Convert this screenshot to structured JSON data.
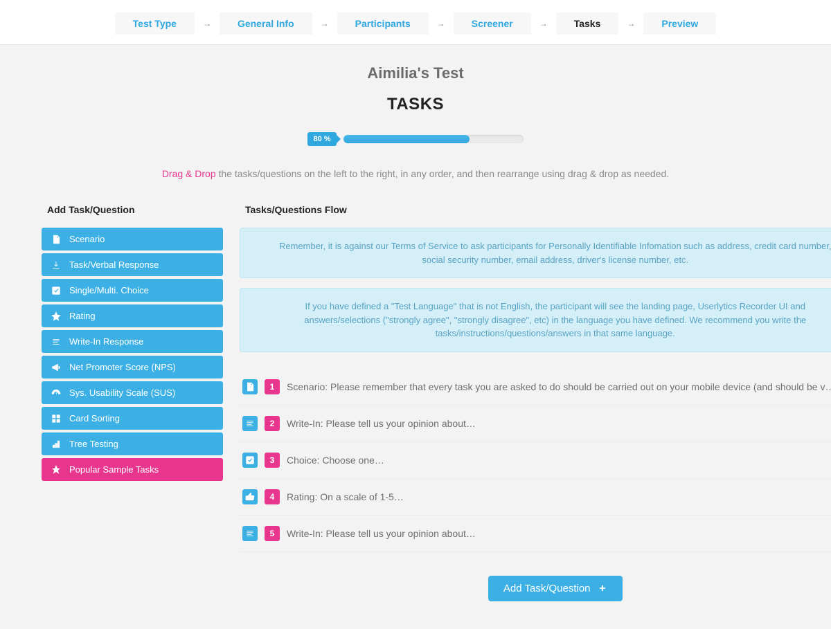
{
  "wizard": {
    "steps": [
      {
        "label": "Test Type",
        "active": false
      },
      {
        "label": "General Info",
        "active": false
      },
      {
        "label": "Participants",
        "active": false
      },
      {
        "label": "Screener",
        "active": false
      },
      {
        "label": "Tasks",
        "active": true
      },
      {
        "label": "Preview",
        "active": false
      }
    ]
  },
  "test_title": "Aimilia's Test",
  "section_title": "TASKS",
  "progress": {
    "label": "80 %",
    "percent": 70
  },
  "instruction": {
    "highlight": "Drag & Drop",
    "rest": " the tasks/questions on the left to the right, in any order, and then rearrange using drag & drop as needed."
  },
  "left": {
    "heading": "Add Task/Question",
    "items": [
      {
        "icon": "file",
        "label": "Scenario",
        "variant": "blue"
      },
      {
        "icon": "download",
        "label": "Task/Verbal Response",
        "variant": "blue"
      },
      {
        "icon": "check",
        "label": "Single/Multi. Choice",
        "variant": "blue"
      },
      {
        "icon": "star",
        "label": "Rating",
        "variant": "blue"
      },
      {
        "icon": "lines",
        "label": "Write-In Response",
        "variant": "blue"
      },
      {
        "icon": "megaphone",
        "label": "Net Promoter Score (NPS)",
        "variant": "blue"
      },
      {
        "icon": "gauge",
        "label": "Sys. Usability Scale (SUS)",
        "variant": "blue"
      },
      {
        "icon": "grid",
        "label": "Card Sorting",
        "variant": "blue"
      },
      {
        "icon": "tree",
        "label": "Tree Testing",
        "variant": "blue"
      },
      {
        "icon": "pin",
        "label": "Popular Sample Tasks",
        "variant": "pink"
      }
    ]
  },
  "right": {
    "heading": "Tasks/Questions Flow",
    "notices": [
      "Remember, it is against our Terms of Service to ask participants for Personally Identifiable Infomation such as address, credit card number, social security number, email address, driver's license number, etc.",
      "If you have defined a \"Test Language\" that is not English, the participant will see the landing page, Userlytics Recorder UI and answers/selections (\"strongly agree\", \"strongly disagree\", etc) in the language you have defined. We recommend you write the tasks/instructions/questions/answers in that same language."
    ],
    "flow": [
      {
        "num": "1",
        "icon": "file",
        "text": "Scenario: Please remember that every task you are asked to do should be carried out on your mobile device (and should be v…",
        "deletable": false
      },
      {
        "num": "2",
        "icon": "lines",
        "text": "Write-In: Please tell us your opinion about…",
        "deletable": true
      },
      {
        "num": "3",
        "icon": "check",
        "text": "Choice: Choose one…",
        "deletable": true
      },
      {
        "num": "4",
        "icon": "thumbs",
        "text": "Rating: On a scale of 1-5…",
        "deletable": true
      },
      {
        "num": "5",
        "icon": "lines",
        "text": "Write-In: Please tell us your opinion about…",
        "deletable": true
      }
    ],
    "add_button": "Add Task/Question"
  }
}
